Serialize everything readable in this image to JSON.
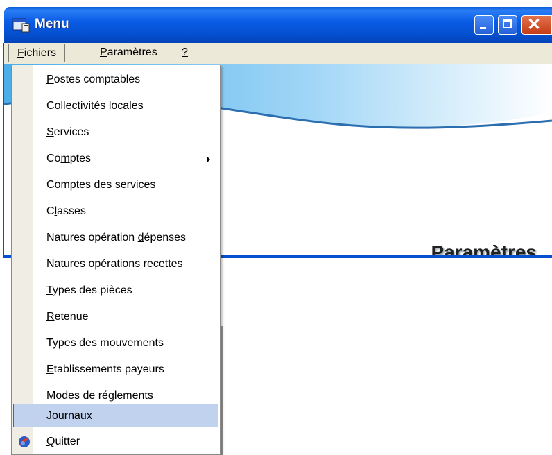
{
  "window": {
    "title": "Menu",
    "icon": "app-window-icon",
    "controls": [
      "minimize-icon",
      "maximize-icon",
      "close-icon"
    ]
  },
  "menubar": {
    "items": [
      {
        "pre": "",
        "ul": "F",
        "post": "ichiers"
      },
      {
        "pre": "",
        "ul": "P",
        "post": "aramètres"
      },
      {
        "pre": "",
        "ul": "?",
        "post": ""
      }
    ]
  },
  "banner": {
    "title": "Paramètres"
  },
  "dropdown": {
    "items": [
      {
        "pre": "",
        "ul": "P",
        "post": "ostes comptables"
      },
      {
        "pre": "",
        "ul": "C",
        "post": "ollectivités locales"
      },
      {
        "pre": "",
        "ul": "S",
        "post": "ervices"
      },
      {
        "pre": "Co",
        "ul": "m",
        "post": "ptes"
      },
      {
        "pre": "",
        "ul": "C",
        "post": "omptes des services"
      },
      {
        "pre": "C",
        "ul": "l",
        "post": "asses"
      },
      {
        "pre": "Natures opération ",
        "ul": "d",
        "post": "épenses"
      },
      {
        "pre": "Natures opérations ",
        "ul": "r",
        "post": "ecettes"
      },
      {
        "pre": "",
        "ul": "T",
        "post": "ypes des pièces"
      },
      {
        "pre": "",
        "ul": "R",
        "post": "etenue"
      },
      {
        "pre": "Types des ",
        "ul": "m",
        "post": "ouvements"
      },
      {
        "pre": "",
        "ul": "E",
        "post": "tablissements payeurs"
      },
      {
        "pre": "",
        "ul": "M",
        "post": "odes de réglements"
      },
      {
        "pre": "",
        "ul": "J",
        "post": "ournaux"
      },
      {
        "pre": "",
        "ul": "Q",
        "post": "uitter"
      }
    ],
    "highlighted_index": 13,
    "submenu_index": 3
  },
  "colors": {
    "titlebar": "#0450d0",
    "menubar": "#ece9d8",
    "highlight": "#c1d2ee",
    "highlight_border": "#316ac5"
  }
}
